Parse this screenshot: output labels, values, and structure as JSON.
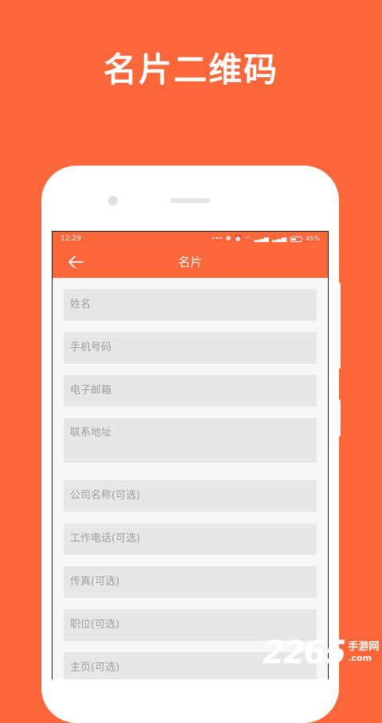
{
  "promo": {
    "headline": "名片二维码"
  },
  "status_bar": {
    "time": "12:29",
    "battery": "45%"
  },
  "app_bar": {
    "title": "名片",
    "back_icon": "arrow-left-icon"
  },
  "form": {
    "fields": [
      {
        "placeholder": "姓名"
      },
      {
        "placeholder": "手机号码"
      },
      {
        "placeholder": "电子邮箱"
      },
      {
        "placeholder": "联系地址"
      },
      {
        "placeholder": "公司名称(可选)"
      },
      {
        "placeholder": "工作电话(可选)"
      },
      {
        "placeholder": "传真(可选)"
      },
      {
        "placeholder": "职位(可选)"
      },
      {
        "placeholder": "主页(可选)"
      }
    ]
  },
  "watermark": {
    "digits": "2265",
    "line1": "手游网",
    "line2": ".com"
  },
  "colors": {
    "brand": "#fd6638",
    "field_bg": "#e7e7e7",
    "placeholder": "#9e9e9e"
  }
}
